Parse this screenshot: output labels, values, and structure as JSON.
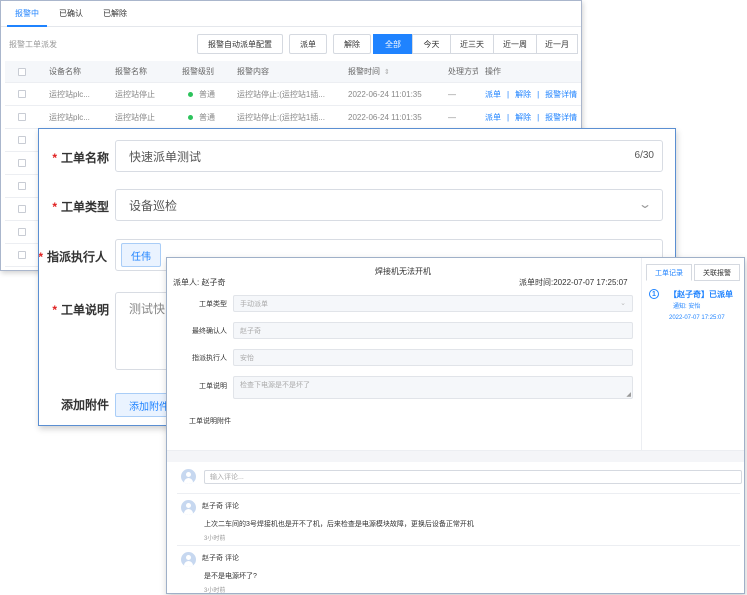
{
  "alarm_list": {
    "tabs": [
      {
        "label": "报警中",
        "active": true
      },
      {
        "label": "已确认",
        "active": false
      },
      {
        "label": "已解除",
        "active": false
      }
    ],
    "section_label": "报警工单派发",
    "buttons": {
      "auto_config": "报警自动派单配置",
      "dispatch": "派单",
      "resolve": "解除"
    },
    "time_filters": [
      {
        "label": "全部",
        "active": true
      },
      {
        "label": "今天",
        "active": false
      },
      {
        "label": "近三天",
        "active": false
      },
      {
        "label": "近一周",
        "active": false
      },
      {
        "label": "近一月",
        "active": false
      }
    ],
    "columns": [
      "设备名称",
      "报警名称",
      "报警级别",
      "报警内容",
      "报警时间",
      "处理方式",
      "操作"
    ],
    "rows": [
      {
        "device": "运控站plc...",
        "alarm": "运控站停止",
        "level": "普通",
        "content": "运控站停止:(运控站1插...",
        "time": "2022-06-24 11:01:35",
        "handling": "—"
      },
      {
        "device": "运控站plc...",
        "alarm": "运控站停止",
        "level": "普通",
        "content": "运控站停止:(运控站1插...",
        "time": "2022-06-24 11:01:35",
        "handling": "—"
      }
    ],
    "actions": {
      "dispatch": "派单",
      "resolve": "解除",
      "detail": "报警详情",
      "separator": "|"
    }
  },
  "dispatch_form": {
    "fields": {
      "name": {
        "label": "工单名称",
        "value": "快速派单测试",
        "counter": "6/30"
      },
      "type": {
        "label": "工单类型",
        "value": "设备巡检"
      },
      "executor": {
        "label": "指派执行人",
        "tag": "任伟"
      },
      "description": {
        "label": "工单说明",
        "value": "测试快"
      },
      "attachment": {
        "label": "添加附件",
        "button": "添加附件"
      }
    }
  },
  "work_order_detail": {
    "title": "焊接机无法开机",
    "dispatcher_label": "派单人:",
    "dispatcher": "赵子奇",
    "dispatch_time_label": "派单时间:",
    "dispatch_time": "2022-07-07 17:25:07",
    "fields": {
      "type": {
        "label": "工单类型",
        "value": "手动派单"
      },
      "confirmer": {
        "label": "最终确认人",
        "value": "赵子奇"
      },
      "executor": {
        "label": "指派执行人",
        "value": "安怡"
      },
      "description": {
        "label": "工单说明",
        "value": "检查下电源是不是坏了"
      },
      "attachment": {
        "label": "工单说明附件"
      }
    },
    "side_tabs": [
      {
        "label": "工单记录",
        "active": true
      },
      {
        "label": "关联报警",
        "active": false
      }
    ],
    "timeline": {
      "step": "1",
      "title": "【赵子奇】已派单",
      "notify": "通知: 安怡",
      "time": "2022-07-07 17:25:07"
    },
    "comment_placeholder": "输入评论...",
    "comments": [
      {
        "author": "赵子奇 评论",
        "text": "上次二车间的3号焊接机也是开不了机，后来检查是电源模块故障，更换后设备正常开机",
        "time": "3小时前"
      },
      {
        "author": "赵子奇 评论",
        "text": "是不是电源坏了?",
        "time": "3小时前"
      }
    ]
  }
}
